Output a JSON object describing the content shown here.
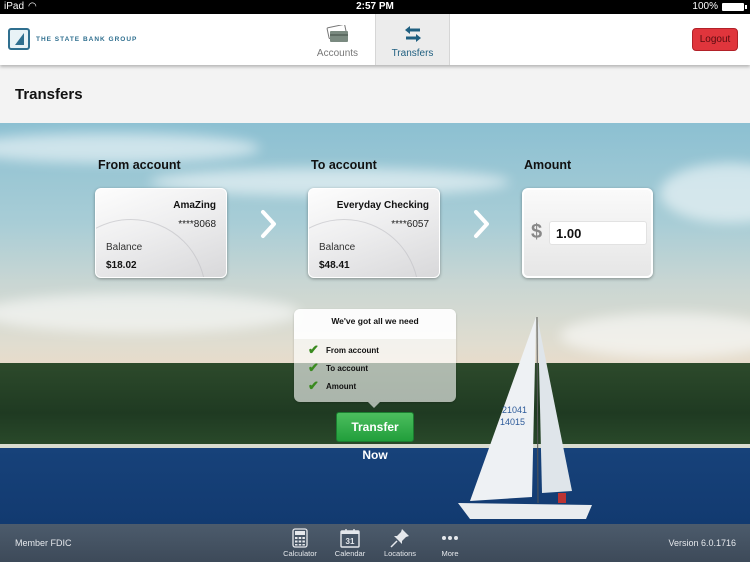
{
  "status_bar": {
    "device": "iPad",
    "time": "2:57 PM",
    "battery": "100%"
  },
  "header": {
    "brand": "THE STATE BANK GROUP",
    "tabs": [
      {
        "label": "Accounts",
        "icon": "credit-card-icon",
        "active": false
      },
      {
        "label": "Transfers",
        "icon": "transfer-arrows-icon",
        "active": true
      }
    ],
    "logout_label": "Logout"
  },
  "page": {
    "title": "Transfers"
  },
  "transfer": {
    "from": {
      "label": "From account",
      "name": "AmaZing",
      "number": "****8068",
      "balance_label": "Balance",
      "balance": "$18.02"
    },
    "to": {
      "label": "To account",
      "name": "Everyday Checking",
      "number": "****6057",
      "balance_label": "Balance",
      "balance": "$48.41"
    },
    "amount": {
      "label": "Amount",
      "currency": "$",
      "value": "1.00"
    },
    "checklist": {
      "title": "We've got all we need",
      "items": [
        {
          "label": "From account",
          "checked": true
        },
        {
          "label": "To account",
          "checked": true
        },
        {
          "label": "Amount",
          "checked": true
        }
      ]
    },
    "submit_label": "Transfer Now"
  },
  "footer": {
    "left": "Member FDIC",
    "right": "Version 6.0.1716",
    "tools": [
      {
        "label": "Calculator",
        "icon": "calculator-icon"
      },
      {
        "label": "Calendar",
        "icon": "calendar-icon",
        "day": "31"
      },
      {
        "label": "Locations",
        "icon": "pushpin-icon"
      },
      {
        "label": "More",
        "icon": "more-dots-icon"
      }
    ]
  },
  "colors": {
    "brand": "#2f6f8f",
    "logout": "#e0353c",
    "submit": "#2faa48",
    "check": "#3a8a1f"
  }
}
